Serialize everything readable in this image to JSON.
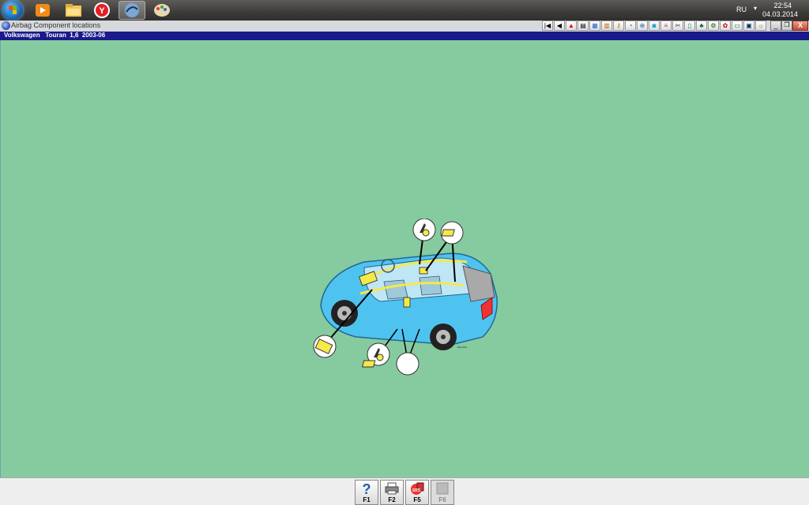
{
  "taskbar": {
    "apps": [
      {
        "name": "media-player-icon"
      },
      {
        "name": "file-explorer-icon"
      },
      {
        "name": "yandex-browser-icon"
      },
      {
        "name": "diagnostic-app-icon",
        "active": true
      },
      {
        "name": "paint-icon"
      }
    ],
    "language": "RU",
    "time": "22:54",
    "date": "04.03.2014"
  },
  "window": {
    "title": "Airbag Component locations",
    "close_label": "X"
  },
  "vehicle": {
    "info": "Volkswagen   Touran  1,6  2003-06"
  },
  "toolbar": {
    "buttons": [
      "first-icon",
      "prev-icon",
      "warning-icon",
      "document-icon",
      "table-icon",
      "chart-icon",
      "key-icon",
      "gauge-icon",
      "plug-icon",
      "car-icon",
      "list-icon",
      "cut-icon",
      "door-icon",
      "tree-icon",
      "engine-icon",
      "paw-icon",
      "monitor-icon",
      "calendar-icon",
      "gear-icon",
      "pin-icon"
    ]
  },
  "diagram": {
    "stamp": "BEL0001"
  },
  "bottom": {
    "keys": [
      {
        "label": "F1",
        "icon": "help-icon",
        "enabled": true
      },
      {
        "label": "F2",
        "icon": "print-icon",
        "enabled": true
      },
      {
        "label": "F5",
        "icon": "srs-icon",
        "enabled": true
      },
      {
        "label": "F6",
        "icon": "blank-icon",
        "enabled": false
      }
    ]
  },
  "colors": {
    "background": "#85cb9f",
    "vehicle_bar": "#1a1a8a",
    "car_body": "#4fc3f0",
    "airbag": "#f5e94a"
  }
}
